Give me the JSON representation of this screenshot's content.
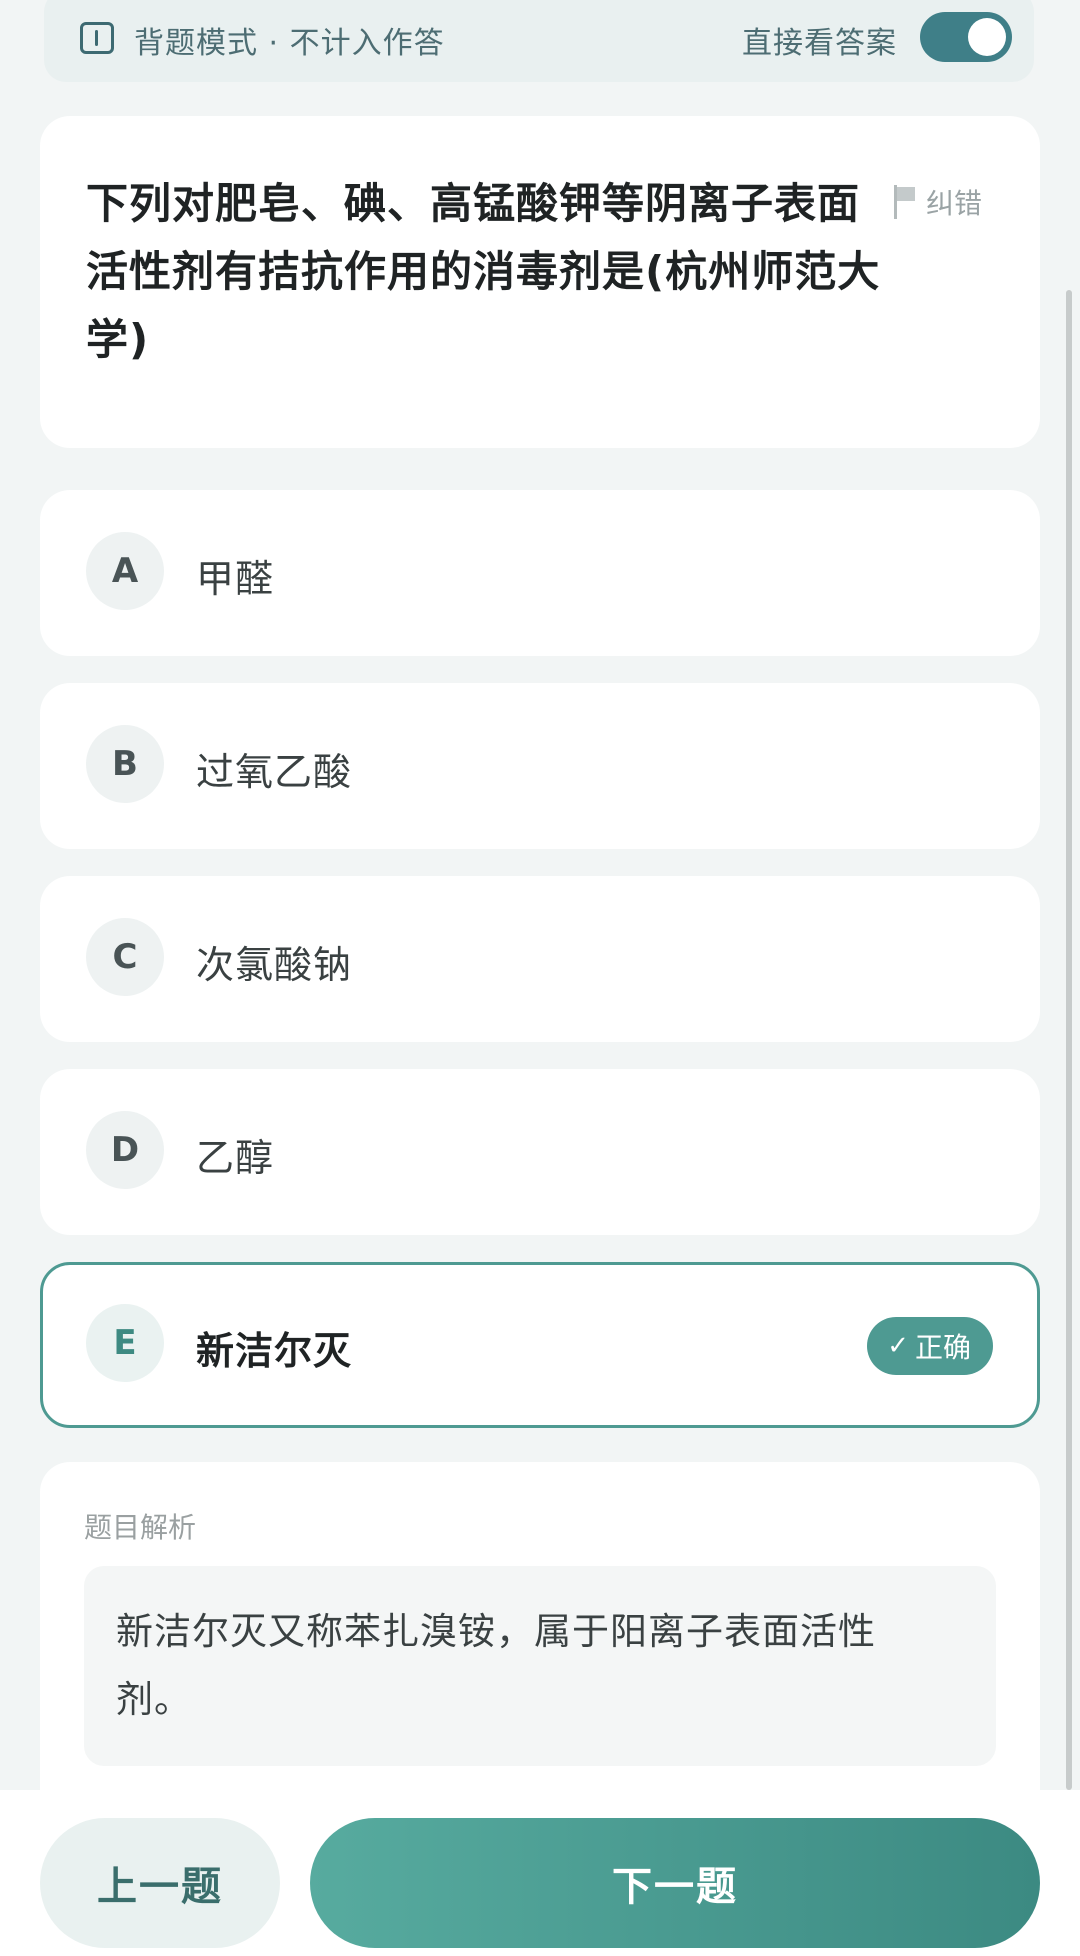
{
  "mode_bar": {
    "mode_label": "背题模式 · 不计入作答",
    "toggle_label": "直接看答案",
    "toggle_on": true,
    "accent_color": "#3f7f88"
  },
  "question": {
    "text": "下列对肥皂、碘、高锰酸钾等阴离子表面活性剂有拮抗作用的消毒剂是(杭州师范大学)",
    "report_label": "纠错"
  },
  "options": [
    {
      "letter": "A",
      "text": "甲醛"
    },
    {
      "letter": "B",
      "text": "过氧乙酸"
    },
    {
      "letter": "C",
      "text": "次氯酸钠"
    },
    {
      "letter": "D",
      "text": "乙醇"
    },
    {
      "letter": "E",
      "text": "新洁尔灭",
      "correct": true
    }
  ],
  "correct_badge": {
    "icon": "check-icon",
    "label": "正确",
    "color": "#4e9a92"
  },
  "analysis": {
    "title": "题目解析",
    "text": "新洁尔灭又称苯扎溴铵，属于阳离子表面活性剂。"
  },
  "nav": {
    "prev_label": "上一题",
    "next_label": "下一题"
  }
}
